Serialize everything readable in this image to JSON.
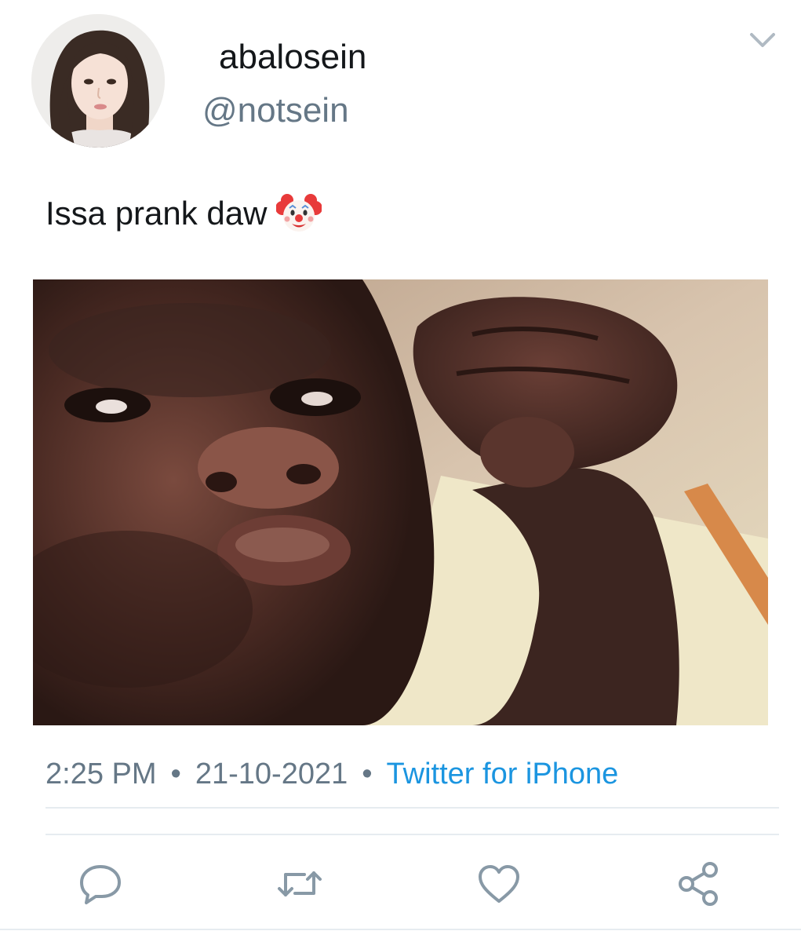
{
  "user": {
    "display_name": "abalosein",
    "handle": "@notsein",
    "avatar_icon": "avatar-photo"
  },
  "tweet": {
    "text": "Issa prank daw",
    "emoji_icon": "clown-face-icon",
    "media_icon": "meme-photo"
  },
  "meta": {
    "time": "2:25 PM",
    "separator": "•",
    "date": "21-10-2021",
    "source": "Twitter for iPhone"
  },
  "actions": {
    "reply_icon": "reply-icon",
    "retweet_icon": "retweet-icon",
    "like_icon": "heart-icon",
    "share_icon": "share-icon"
  },
  "colors": {
    "text_primary": "#14171a",
    "text_secondary": "#657786",
    "link": "#1b95e0",
    "divider": "#e6ecf0",
    "icon": "#8899a6"
  }
}
